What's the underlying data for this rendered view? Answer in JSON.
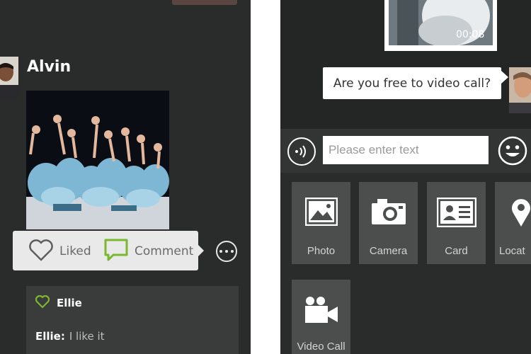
{
  "left_panel": {
    "post": {
      "author": "Alvin"
    },
    "actions": {
      "like_label": "Liked",
      "comment_label": "Comment"
    },
    "likes": {
      "names": "Ellie"
    },
    "comments": [
      {
        "author": "Ellie:",
        "text": "I like it"
      }
    ]
  },
  "right_panel": {
    "video_message": {
      "duration": "00:08"
    },
    "text_message": "Are you free to video call?",
    "input": {
      "placeholder": "Please enter text"
    },
    "attachments": [
      {
        "label": "Photo",
        "icon": "photo-icon"
      },
      {
        "label": "Camera",
        "icon": "camera-icon"
      },
      {
        "label": "Card",
        "icon": "contact-card-icon"
      },
      {
        "label": "Locat",
        "icon": "location-pin-icon"
      },
      {
        "label": "Video Call",
        "icon": "video-camera-icon"
      }
    ]
  },
  "colors": {
    "background": "#2a2b2b",
    "accent_green": "#7ab82e",
    "tile": "#4c4e4e",
    "popup": "#e9e9e9"
  }
}
